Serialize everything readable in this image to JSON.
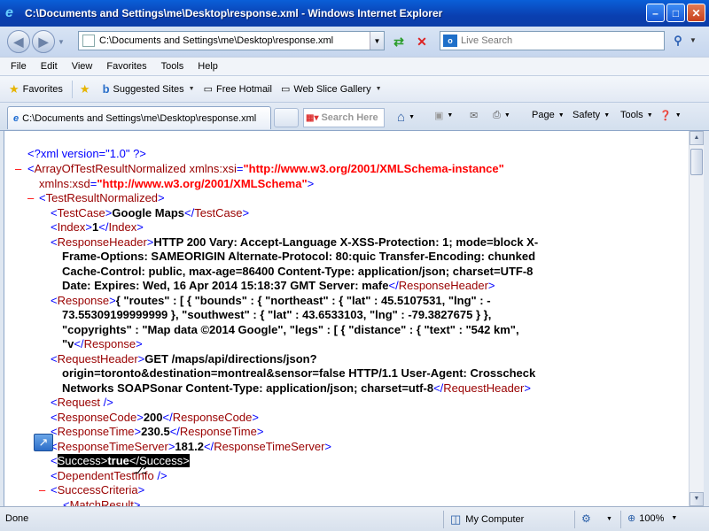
{
  "window": {
    "title": "C:\\Documents and Settings\\me\\Desktop\\response.xml - Windows Internet Explorer",
    "minimize": "–",
    "maximize": "□",
    "close": "✕"
  },
  "address": {
    "value": "C:\\Documents and Settings\\me\\Desktop\\response.xml",
    "search_placeholder": "Live Search"
  },
  "menu": [
    "File",
    "Edit",
    "View",
    "Favorites",
    "Tools",
    "Help"
  ],
  "favorites_bar": {
    "favorites_label": "Favorites",
    "suggested_sites": "Suggested Sites",
    "free_hotmail": "Free Hotmail",
    "web_slice_gallery": "Web Slice Gallery"
  },
  "tab": {
    "title": "C:\\Documents and Settings\\me\\Desktop\\response.xml",
    "search_placeholder": "Search Here"
  },
  "commands": {
    "page": "Page",
    "safety": "Safety",
    "tools": "Tools"
  },
  "xml": {
    "pi": "<?xml version=\"1.0\" ?>",
    "root_tag": "ArrayOfTestResultNormalized",
    "xmlns_xsi_attr": "xmlns:xsi",
    "xmlns_xsi_val": "\"http://www.w3.org/2001/XMLSchema-instance\"",
    "xmlns_xsd_attr": "xmlns:xsd",
    "xmlns_xsd_val": "\"http://www.w3.org/2001/XMLSchema\"",
    "test_result": "TestResultNormalized",
    "test_case_tag": "TestCase",
    "test_case_val": "Google Maps",
    "index_tag": "Index",
    "index_val": "1",
    "resp_header_tag": "ResponseHeader",
    "resp_header_lines": [
      "HTTP 200 Vary: Accept-Language X-XSS-Protection: 1; mode=block X-",
      "Frame-Options: SAMEORIGIN Alternate-Protocol: 80:quic Transfer-Encoding: chunked",
      "Cache-Control: public, max-age=86400 Content-Type: application/json; charset=UTF-8",
      "Date: Expires: Wed, 16 Apr 2014 15:18:37 GMT Server: mafe"
    ],
    "response_tag": "Response",
    "response_lines": [
      "{ \"routes\" : [ { \"bounds\" : { \"northeast\" : { \"lat\" : 45.5107531, \"lng\" : -",
      "73.55309199999999 }, \"southwest\" : { \"lat\" : 43.6533103, \"lng\" : -79.3827675 } },",
      "\"copyrights\" : \"Map data ©2014 Google\", \"legs\" : [ { \"distance\" : { \"text\" : \"542 km\",",
      "\"v"
    ],
    "req_header_tag": "RequestHeader",
    "req_header_lines": [
      "GET /maps/api/directions/json?",
      "origin=toronto&destination=montreal&sensor=false HTTP/1.1 User-Agent: Crosscheck",
      "Networks SOAPSonar Content-Type: application/json; charset=utf-8"
    ],
    "request_tag": "Request",
    "resp_code_tag": "ResponseCode",
    "resp_code_val": "200",
    "resp_time_tag": "ResponseTime",
    "resp_time_val": "230.5",
    "resp_time_server_tag": "ResponseTimeServer",
    "resp_time_server_val": "181.2",
    "success_tag": "Success",
    "success_val": "true",
    "dependent_tag": "DependentTestInfo",
    "criteria_tag": "SuccessCriteria",
    "match_tag": "MatchResult"
  },
  "status": {
    "text": "Done",
    "zone": "My Computer",
    "zoom": "100%"
  }
}
